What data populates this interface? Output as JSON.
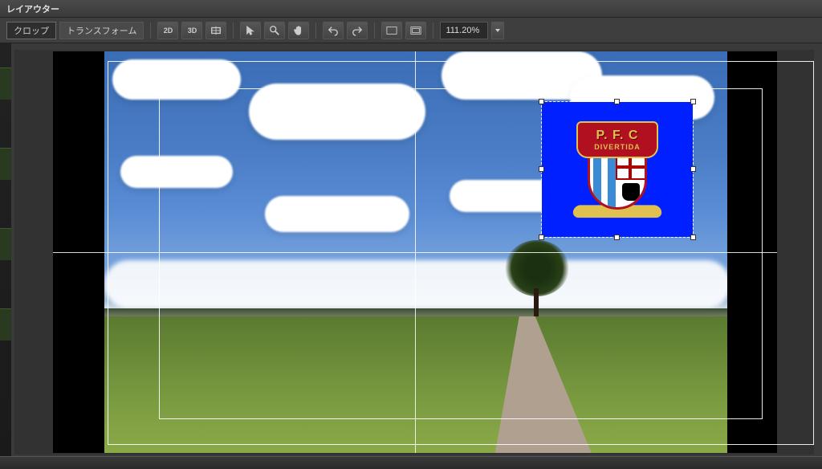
{
  "window": {
    "title": "レイアウター"
  },
  "tabs": {
    "crop": "クロップ",
    "transform": "トランスフォーム"
  },
  "toolbar": {
    "mode2d": "2D",
    "mode3d": "3D",
    "zoom_value": "111.20%"
  },
  "badge": {
    "line1": "P. F. C",
    "line2": "DIVERTIDA"
  }
}
